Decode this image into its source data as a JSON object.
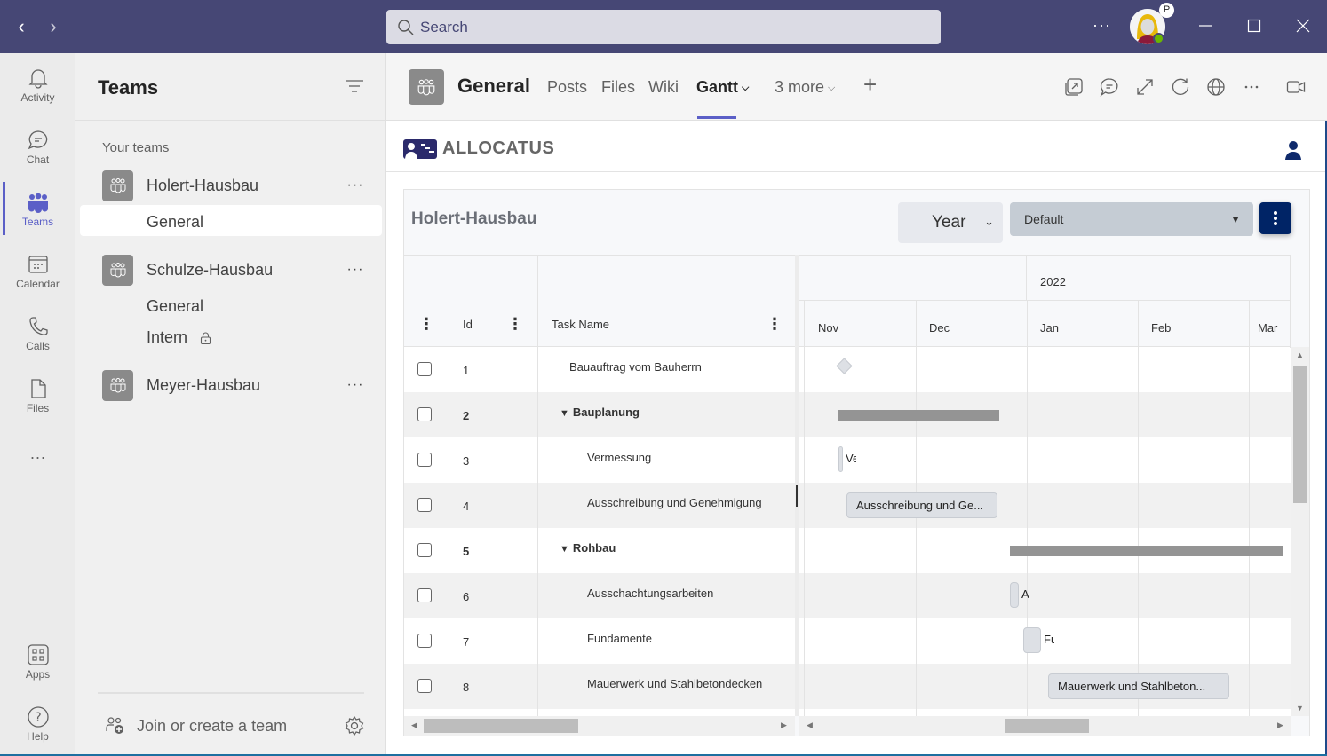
{
  "titlebar": {
    "search_placeholder": "Search",
    "more_label": "···",
    "avatar_badge": "P",
    "colors": {
      "bar": "#464775",
      "presence": "#6bb700"
    }
  },
  "rail": {
    "items": [
      {
        "label": "Activity",
        "icon": "bell-icon"
      },
      {
        "label": "Chat",
        "icon": "chat-icon"
      },
      {
        "label": "Teams",
        "icon": "teams-icon",
        "active": true
      },
      {
        "label": "Calendar",
        "icon": "calendar-icon"
      },
      {
        "label": "Calls",
        "icon": "phone-icon"
      },
      {
        "label": "Files",
        "icon": "file-icon"
      }
    ],
    "more_label": "···",
    "bottom_items": [
      {
        "label": "Apps",
        "icon": "apps-icon"
      },
      {
        "label": "Help",
        "icon": "help-icon"
      }
    ],
    "accent": "#5b5fc7"
  },
  "teams_panel": {
    "title": "Teams",
    "section_label": "Your teams",
    "teams": [
      {
        "name": "Holert-Hausbau",
        "channels": [
          {
            "name": "General",
            "active": true
          }
        ]
      },
      {
        "name": "Schulze-Hausbau",
        "channels": [
          {
            "name": "General"
          },
          {
            "name": "Intern",
            "private": true
          }
        ]
      },
      {
        "name": "Meyer-Hausbau",
        "channels": []
      }
    ],
    "more_label": "···",
    "join_label": "Join or create a team"
  },
  "channel_header": {
    "title": "General",
    "tabs": [
      {
        "label": "Posts"
      },
      {
        "label": "Files"
      },
      {
        "label": "Wiki"
      },
      {
        "label": "Gantt",
        "active": true,
        "has_dropdown": true
      },
      {
        "label": "3 more",
        "has_dropdown": true
      }
    ],
    "add_tab_label": "+"
  },
  "app": {
    "logo_text": "ALLOCATUS",
    "brand_color": "#2b2a6b",
    "project_title": "Holert-Hausbau",
    "view_select": {
      "value": "Year"
    },
    "layout_select": {
      "value": "Default"
    },
    "kebab_color": "#002466",
    "grid": {
      "columns": [
        {
          "label": ""
        },
        {
          "label": "Id"
        },
        {
          "label": "Task Name"
        }
      ],
      "rows": [
        {
          "id": "1",
          "name": "Bauauftrag vom Bauherrn",
          "level": 1,
          "parent": false
        },
        {
          "id": "2",
          "name": "Bauplanung",
          "level": 0,
          "parent": true
        },
        {
          "id": "3",
          "name": "Vermessung",
          "level": 1,
          "parent": false
        },
        {
          "id": "4",
          "name": "Ausschreibung und Genehmigung",
          "level": 1,
          "parent": false
        },
        {
          "id": "5",
          "name": "Rohbau",
          "level": 0,
          "parent": true
        },
        {
          "id": "6",
          "name": "Ausschachtungsarbeiten",
          "level": 1,
          "parent": false
        },
        {
          "id": "7",
          "name": "Fundamente",
          "level": 1,
          "parent": false
        },
        {
          "id": "8",
          "name": "Mauerwerk und Stahlbetondecken",
          "level": 1,
          "parent": false
        }
      ]
    },
    "timeline": {
      "year_label": "2022",
      "months": [
        "Nov",
        "Dec",
        "Jan",
        "Feb",
        "Mar"
      ],
      "bars": [
        {
          "row": 0,
          "type": "milestone"
        },
        {
          "row": 1,
          "type": "summary"
        },
        {
          "row": 2,
          "type": "task",
          "label": "Ve",
          "tiny": true
        },
        {
          "row": 3,
          "type": "task",
          "label": "Ausschreibung und Ge..."
        },
        {
          "row": 4,
          "type": "summary"
        },
        {
          "row": 5,
          "type": "task",
          "label": "A",
          "tiny": true
        },
        {
          "row": 6,
          "type": "task",
          "label": "Fu",
          "tiny": true
        },
        {
          "row": 7,
          "type": "task",
          "label": "Mauerwerk und Stahlbeton..."
        }
      ],
      "today_color": "#d9001b"
    }
  }
}
